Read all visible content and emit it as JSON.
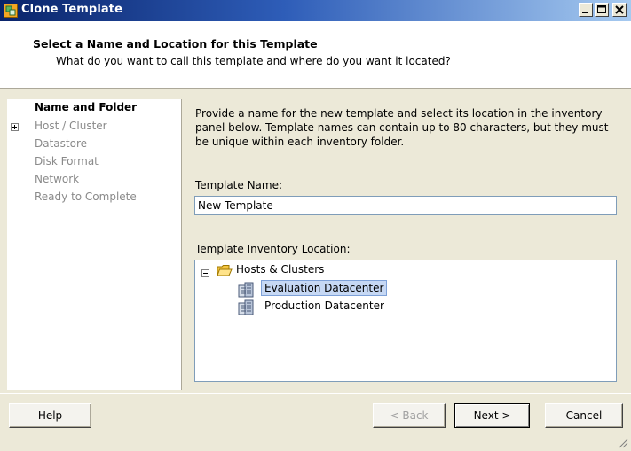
{
  "window": {
    "title": "Clone Template"
  },
  "header": {
    "title": "Select a Name and Location for this Template",
    "subtitle": "What do you want to call this template and where do you want it located?"
  },
  "steps": [
    {
      "label": "Name and Folder",
      "active": true
    },
    {
      "label": "Host / Cluster",
      "active": false
    },
    {
      "label": "Datastore",
      "active": false
    },
    {
      "label": "Disk Format",
      "active": false
    },
    {
      "label": "Network",
      "active": false
    },
    {
      "label": "Ready to Complete",
      "active": false
    }
  ],
  "content": {
    "description": "Provide a name for the new template and select its location in the inventory panel below. Template names can contain up to 80 characters, but they must be unique within each inventory folder.",
    "name_label": "Template Name:",
    "name_value": "New Template",
    "location_label": "Template Inventory Location:",
    "tree": {
      "root": "Hosts & Clusters",
      "children": [
        {
          "label": "Evaluation Datacenter",
          "selected": true
        },
        {
          "label": "Production Datacenter",
          "selected": false
        }
      ]
    }
  },
  "buttons": {
    "help": "Help",
    "back": "< Back",
    "next": "Next >",
    "cancel": "Cancel"
  },
  "icons": {
    "app": "clone-template-icon",
    "folder": "folder-icon",
    "datacenter": "datacenter-icon"
  }
}
